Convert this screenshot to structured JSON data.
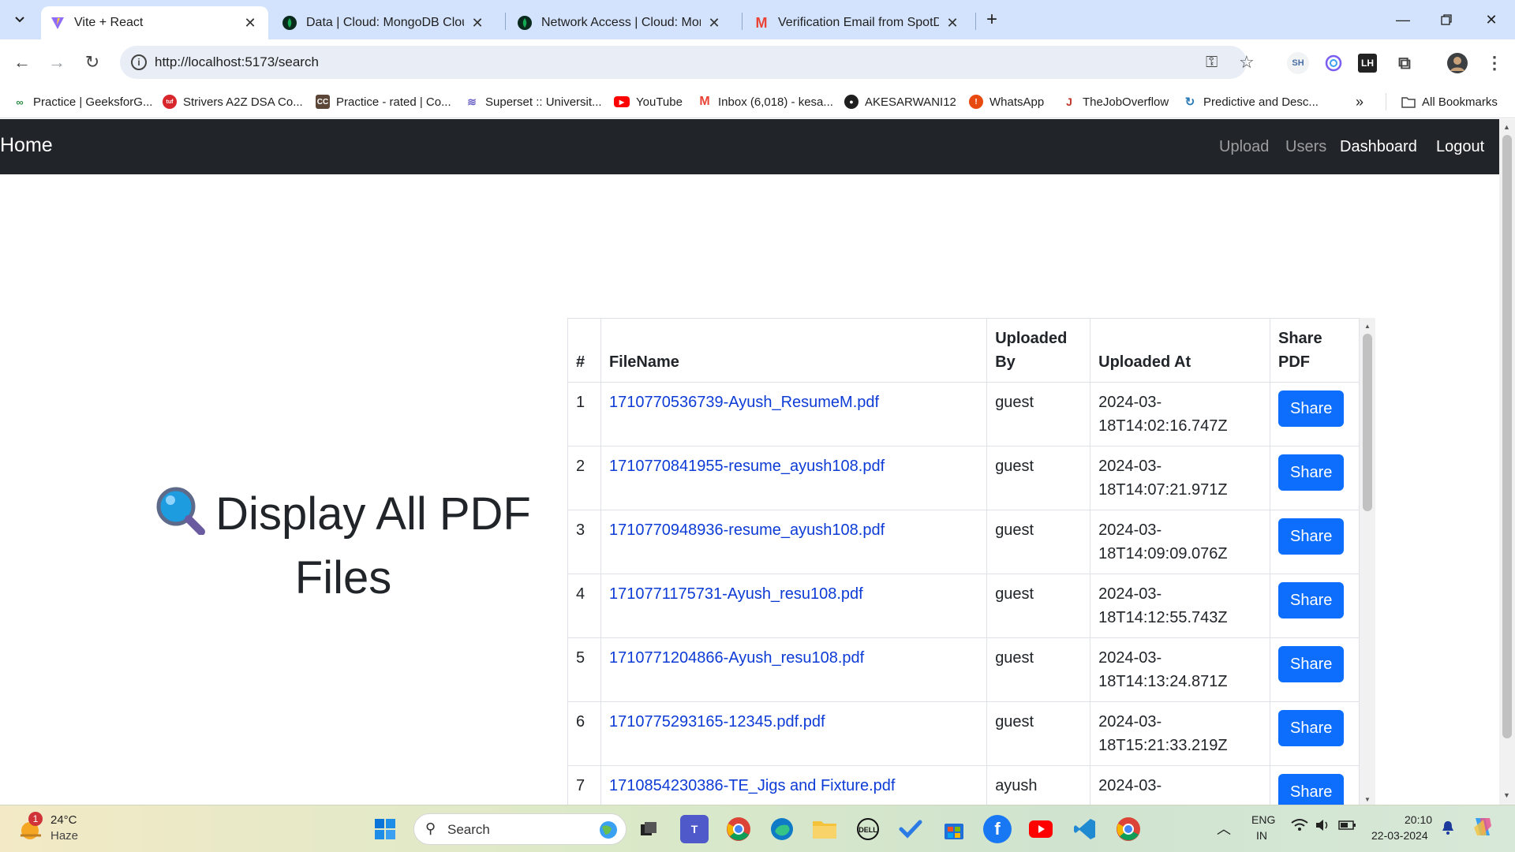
{
  "browser": {
    "tabs": [
      {
        "title": "Vite + React",
        "favicon": "vite-icon",
        "active": true
      },
      {
        "title": "Data | Cloud: MongoDB Cloud",
        "favicon": "mongodb-icon",
        "active": false
      },
      {
        "title": "Network Access | Cloud: Mongo",
        "favicon": "mongodb-icon",
        "active": false
      },
      {
        "title": "Verification Email from SpotDra",
        "favicon": "gmail-icon",
        "active": false
      }
    ],
    "url": "http://localhost:5173/search",
    "profile_ext_label": "SH",
    "bookmarks": [
      {
        "label": "Practice | GeeksforG...",
        "icon": "gfg-icon",
        "color": "#2f8d46"
      },
      {
        "label": "Strivers A2Z DSA Co...",
        "icon": "tuf-icon",
        "color": "#d8262d"
      },
      {
        "label": "Practice - rated | Co...",
        "icon": "codechef-icon",
        "color": "#5b4638"
      },
      {
        "label": "Superset :: Universit...",
        "icon": "superset-icon",
        "color": "#6c63c7"
      },
      {
        "label": "YouTube",
        "icon": "youtube-icon",
        "color": "#ff0000"
      },
      {
        "label": "Inbox (6,018) - kesa...",
        "icon": "gmail-icon",
        "color": "#ea4335"
      },
      {
        "label": "AKESARWANI12",
        "icon": "github-icon",
        "color": "#1f1f1f"
      },
      {
        "label": "WhatsApp",
        "icon": "whatsapp-icon",
        "color": "#e8490f"
      },
      {
        "label": "TheJobOverflow",
        "icon": "jobs-icon",
        "color": "#c0392b"
      },
      {
        "label": "Predictive and Desc...",
        "icon": "predictive-icon",
        "color": "#2a7ab8"
      }
    ],
    "all_bookmarks_label": "All Bookmarks"
  },
  "app": {
    "brand": "Home",
    "nav_links": [
      "Upload",
      "Users",
      "Dashboard",
      "Logout"
    ],
    "heading": "Display All PDF Files",
    "table": {
      "headers": [
        "#",
        "FileName",
        "Uploaded By",
        "Uploaded At",
        "Share PDF"
      ],
      "rows": [
        {
          "num": "1",
          "file": "1710770536739-Ayush_ResumeM.pdf",
          "by": "guest",
          "at": "2024-03-18T14:02:16.747Z",
          "share": "Share"
        },
        {
          "num": "2",
          "file": "1710770841955-resume_ayush108.pdf",
          "by": "guest",
          "at": "2024-03-18T14:07:21.971Z",
          "share": "Share"
        },
        {
          "num": "3",
          "file": "1710770948936-resume_ayush108.pdf",
          "by": "guest",
          "at": "2024-03-18T14:09:09.076Z",
          "share": "Share"
        },
        {
          "num": "4",
          "file": "1710771175731-Ayush_resu108.pdf",
          "by": "guest",
          "at": "2024-03-18T14:12:55.743Z",
          "share": "Share"
        },
        {
          "num": "5",
          "file": "1710771204866-Ayush_resu108.pdf",
          "by": "guest",
          "at": "2024-03-18T14:13:24.871Z",
          "share": "Share"
        },
        {
          "num": "6",
          "file": "1710775293165-12345.pdf.pdf",
          "by": "guest",
          "at": "2024-03-18T15:21:33.219Z",
          "share": "Share"
        },
        {
          "num": "7",
          "file": "1710854230386-TE_Jigs and Fixture.pdf",
          "by": "ayush",
          "at": "2024-03-",
          "share": "Share"
        }
      ]
    }
  },
  "taskbar": {
    "weather": {
      "temp": "24°C",
      "condition": "Haze",
      "badge": "1"
    },
    "search_placeholder": "Search",
    "lang": "ENG",
    "region": "IN",
    "time": "20:10",
    "date": "22-03-2024"
  }
}
